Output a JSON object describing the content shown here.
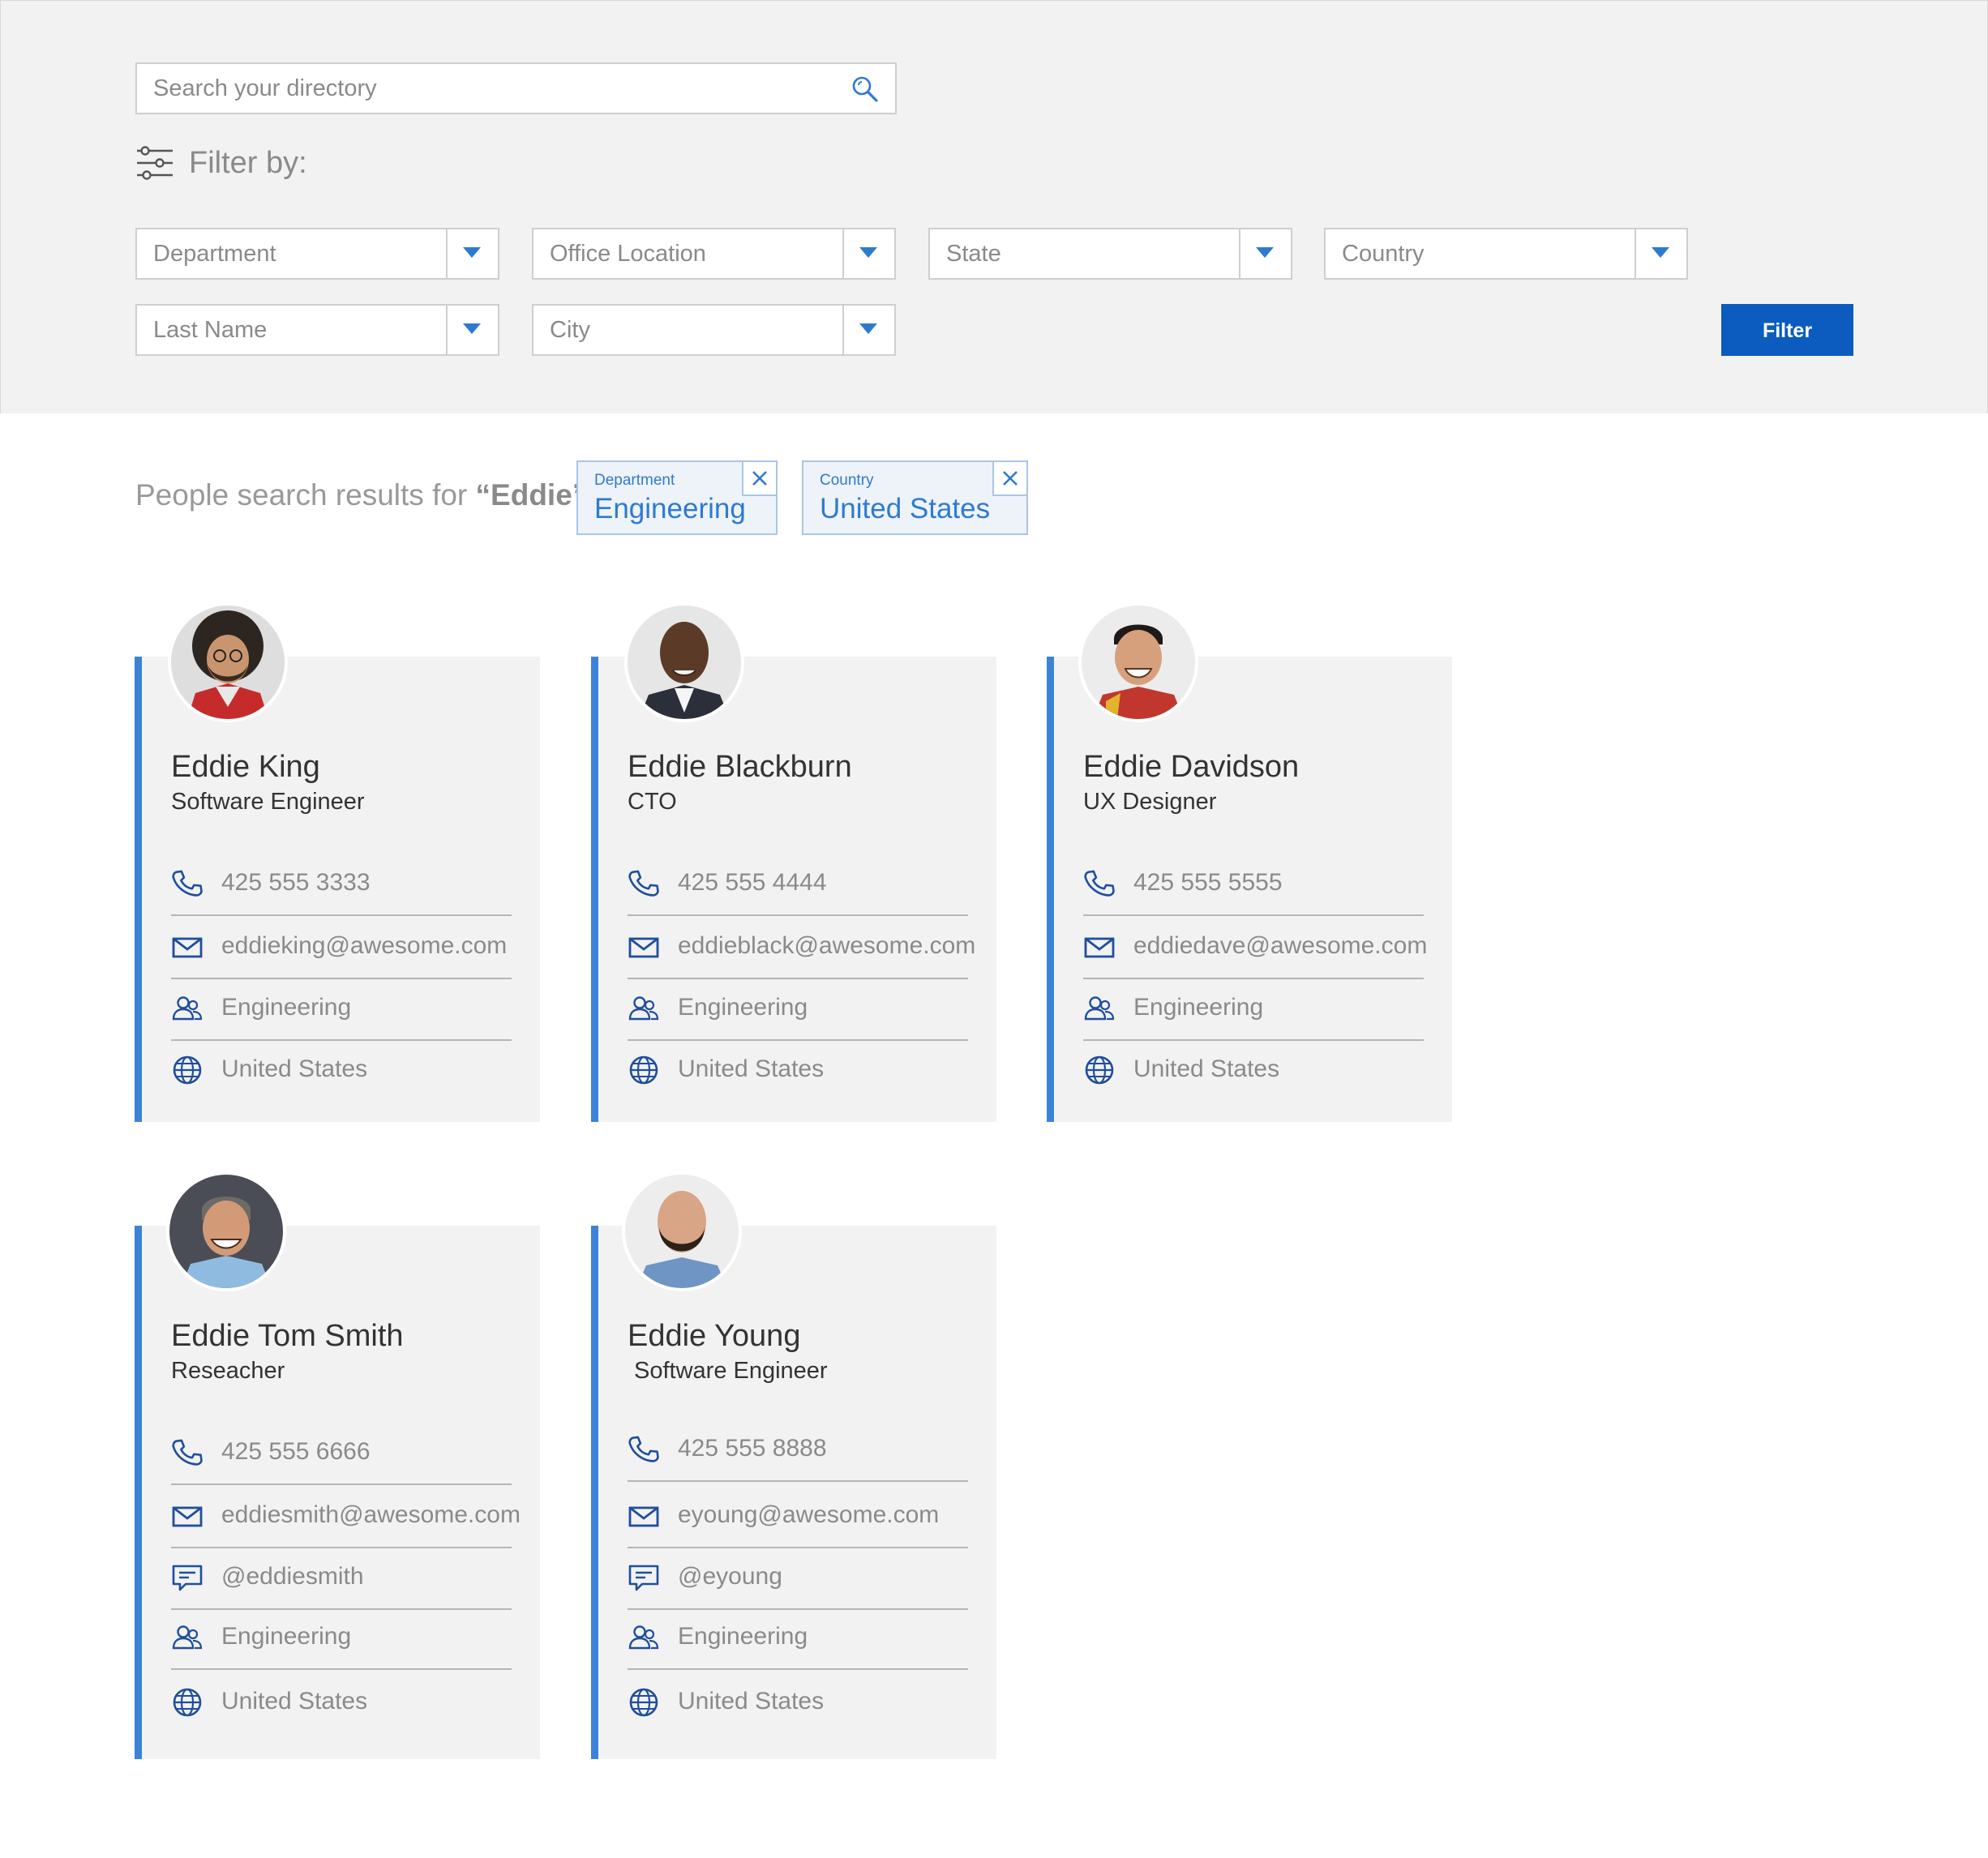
{
  "search": {
    "placeholder": "Search your directory"
  },
  "filters": {
    "heading": "Filter by:",
    "dropdowns": [
      "Department",
      "Office Location",
      "State",
      "Country",
      "Last Name",
      "City"
    ],
    "button": "Filter"
  },
  "results": {
    "prefix": "People search results for ",
    "query": "“Eddie”",
    "chips": [
      {
        "label": "Department",
        "value": "Engineering"
      },
      {
        "label": "Country",
        "value": "United States"
      }
    ]
  },
  "people": [
    {
      "name": "Eddie King",
      "title": "Software Engineer",
      "phone": "425 555 3333",
      "email": "eddieking@awesome.com",
      "department": "Engineering",
      "country": "United States"
    },
    {
      "name": "Eddie Blackburn",
      "title": "CTO",
      "phone": "425 555 4444",
      "email": "eddieblack@awesome.com",
      "department": "Engineering",
      "country": "United States"
    },
    {
      "name": "Eddie Davidson",
      "title": "UX Designer",
      "phone": "425 555 5555",
      "email": "eddiedave@awesome.com",
      "department": "Engineering",
      "country": "United States"
    },
    {
      "name": "Eddie Tom Smith",
      "title": "Reseacher",
      "phone": "425 555 6666",
      "email": "eddiesmith@awesome.com",
      "chat": "@eddiesmith",
      "department": "Engineering",
      "country": "United States"
    },
    {
      "name": "Eddie Young",
      "title": "Software Engineer",
      "phone": "425 555 8888",
      "email": "eyoung@awesome.com",
      "chat": "@eyoung",
      "department": "Engineering",
      "country": "United States"
    }
  ],
  "colors": {
    "accent": "#3b83d9",
    "button": "#0b5cbe",
    "icon": "#1f4e9c",
    "panel": "#f2f2f2"
  },
  "icons": [
    "search-icon",
    "filter-sliders-icon",
    "chevron-down-icon",
    "close-icon",
    "phone-icon",
    "email-icon",
    "chat-icon",
    "people-icon",
    "globe-icon"
  ]
}
